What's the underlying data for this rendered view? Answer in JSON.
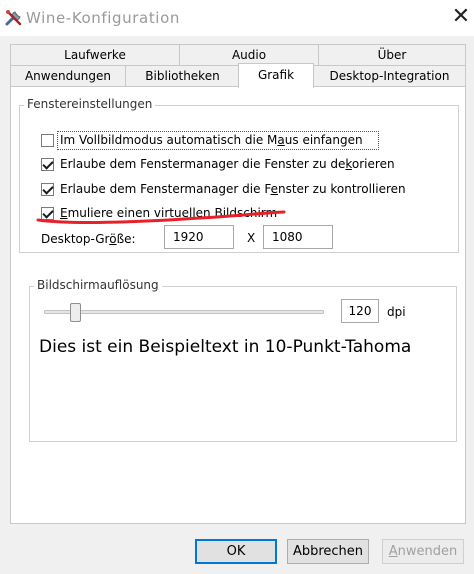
{
  "window": {
    "title": "Wine-Konfiguration",
    "app_icon": "wine-tools-icon",
    "close_glyph": "✕"
  },
  "tabs": {
    "upper": [
      {
        "label": "Laufwerke"
      },
      {
        "label": "Audio"
      },
      {
        "label": "Über"
      }
    ],
    "lower": [
      {
        "label": "Anwendungen"
      },
      {
        "label": "Bibliotheken"
      },
      {
        "label": "Grafik",
        "active": true
      },
      {
        "label": "Desktop-Integration"
      }
    ]
  },
  "window_settings": {
    "legend": "Fenstereinstellungen",
    "options": [
      {
        "before": "Im Vollbildmodus automatisch die M",
        "mnemonic": "a",
        "after": "us einfangen",
        "checked": false,
        "focused": true
      },
      {
        "before": "Erlaube dem Fenstermanager die Fenster zu de",
        "mnemonic": "k",
        "after": "orieren",
        "checked": true
      },
      {
        "before": "Erlaube dem Fenstermanager die F",
        "mnemonic": "e",
        "after": "nster zu kontrollieren",
        "checked": true
      },
      {
        "before": "",
        "mnemonic": "E",
        "after": "muliere einen virtuellen Bildschirm",
        "checked": true
      }
    ],
    "desktop_size": {
      "label_before": "Desktop-Gr",
      "mnemonic": "ö",
      "label_after": "ße:",
      "width": "1920",
      "separator": "X",
      "height": "1080"
    }
  },
  "resolution": {
    "legend": "Bildschirmauflösung",
    "dpi_value": "120",
    "dpi_unit": "dpi",
    "slider_fraction": 0.11,
    "sample_text": "Dies ist ein Beispieltext in 10-Punkt-Tahoma"
  },
  "buttons": {
    "ok": "OK",
    "cancel": "Abbrechen",
    "apply_mnemonic": "A",
    "apply_rest": "nwenden"
  },
  "colors": {
    "annotation_stroke": "#e8202a",
    "focus_border": "#0078d7"
  }
}
